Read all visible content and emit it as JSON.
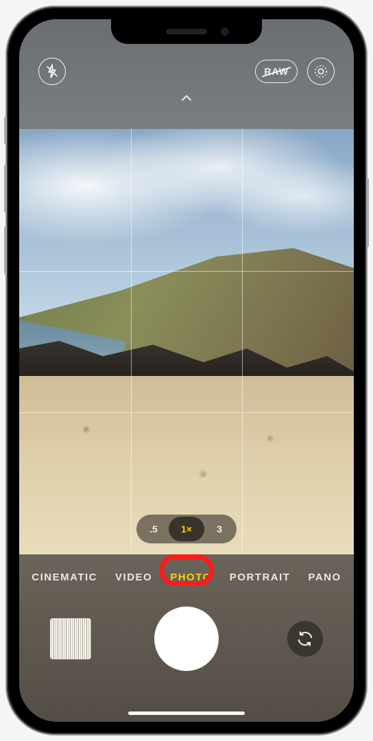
{
  "top": {
    "raw_label": "RAW"
  },
  "zoom": {
    "options": [
      ".5",
      "1×",
      "3"
    ],
    "selected_index": 1
  },
  "modes": {
    "items": [
      "CINEMATIC",
      "VIDEO",
      "PHOTO",
      "PORTRAIT",
      "PANO"
    ],
    "selected_index": 2
  },
  "highlight": {
    "target_mode_index": 2,
    "color": "#ff1a1a"
  },
  "icons": {
    "flash": "flash-off-icon",
    "chevron": "chevron-up-icon",
    "live": "live-photo-icon",
    "flip": "camera-flip-icon"
  }
}
